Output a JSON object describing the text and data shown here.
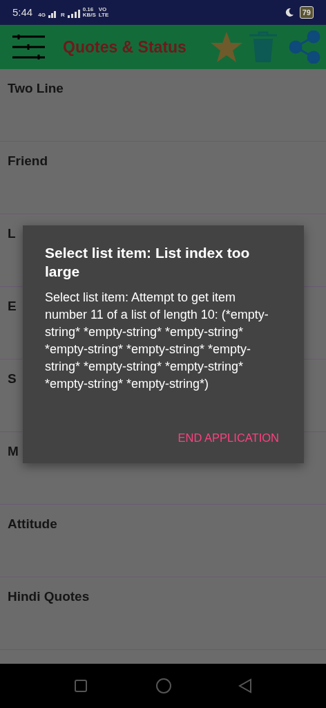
{
  "status_bar": {
    "time": "5:44",
    "network": "4G",
    "roaming": "R",
    "speed": "0.16",
    "speed_unit": "KB/S",
    "volte": "VO",
    "lte": "LTE",
    "battery": "79"
  },
  "toolbar": {
    "title": "Quotes & Status"
  },
  "list": [
    {
      "label": "Two Line"
    },
    {
      "label": "Friend"
    },
    {
      "label": "L"
    },
    {
      "label": "E"
    },
    {
      "label": "S"
    },
    {
      "label": "M"
    },
    {
      "label": "Attitude"
    },
    {
      "label": "Hindi Quotes"
    }
  ],
  "dialog": {
    "title": "Select list item: List index too large",
    "message": "Select list item: Attempt to get item number 11 of a list of length 10: (*empty-string* *empty-string* *empty-string* *empty-string* *empty-string* *empty-string* *empty-string* *empty-string* *empty-string* *empty-string*)",
    "button": "END APPLICATION"
  }
}
